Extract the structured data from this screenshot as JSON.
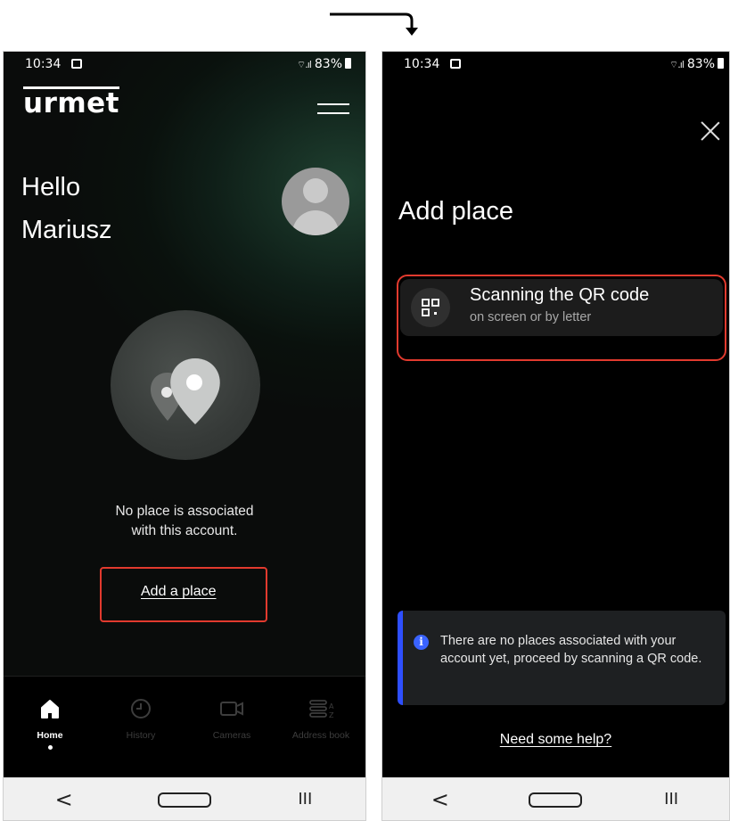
{
  "left_screen": {
    "status": {
      "time": "10:34",
      "battery": "83%"
    },
    "logo": "urmet",
    "greeting_line1": "Hello",
    "greeting_line2": "Mariusz",
    "empty_message_line1": "No place is associated",
    "empty_message_line2": "with this account.",
    "add_place_link": "Add a place",
    "tabs": [
      {
        "label": "Home",
        "icon": "home-icon",
        "active": true
      },
      {
        "label": "History",
        "icon": "clock-icon",
        "active": false
      },
      {
        "label": "Cameras",
        "icon": "camera-icon",
        "active": false
      },
      {
        "label": "Address book",
        "icon": "address-book-icon",
        "active": false
      }
    ],
    "nav": {
      "back": "<",
      "home": "",
      "recents": "III"
    }
  },
  "right_screen": {
    "status": {
      "time": "10:34",
      "battery": "83%"
    },
    "title": "Add place",
    "option": {
      "title": "Scanning the QR code",
      "subtitle": "on screen or by letter",
      "icon": "qr-code-icon"
    },
    "info_text": "There are no places associated with your account yet, proceed by scanning a QR code.",
    "help_link": "Need some help?",
    "nav": {
      "back": "<",
      "home": "",
      "recents": "III"
    }
  },
  "colors": {
    "highlight": "#e23a2e",
    "info_accent": "#2e4fff",
    "background": "#000000"
  }
}
